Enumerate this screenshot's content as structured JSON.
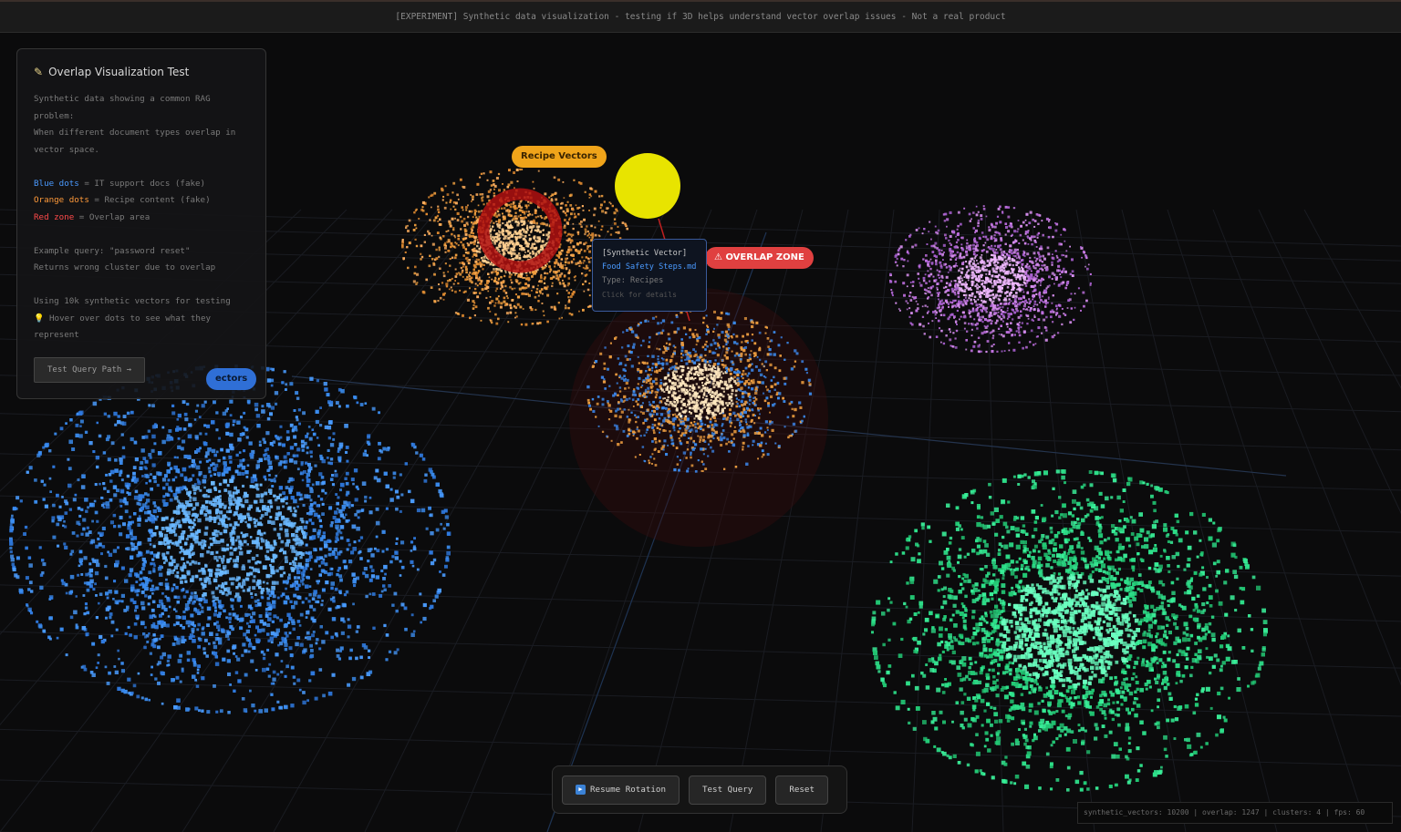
{
  "banner": {
    "text": "[EXPERIMENT] Synthetic data visualization - testing if 3D helps understand vector overlap issues - Not a real product"
  },
  "panel": {
    "title": "Overlap Visualization Test",
    "intro_1": "Synthetic data showing a common RAG",
    "intro_2": "problem:",
    "intro_3": "When different document types overlap in",
    "intro_4": "vector space.",
    "legend_blue_term": "Blue dots",
    "legend_blue_desc": " = IT support docs (fake)",
    "legend_orange_term": "Orange dots",
    "legend_orange_desc": " = Recipe content (fake)",
    "legend_red_term": "Red zone",
    "legend_red_desc": " = Overlap area",
    "query_1": "Example query: \"password reset\"",
    "query_2": "Returns wrong cluster due to overlap",
    "using": "Using 10k synthetic vectors for testing",
    "hover_1": "Hover over dots to see what they",
    "hover_2": "represent",
    "button": "Test Query Path →"
  },
  "labels": {
    "recipe": "Recipe Vectors",
    "overlap": "⚠ OVERLAP ZONE",
    "it": "ectors"
  },
  "tooltip": {
    "head": "[Synthetic Vector]",
    "file": "Food Safety Steps.md",
    "type": "Type: Recipes",
    "hint": "Click for details"
  },
  "controls": {
    "resume": "Resume Rotation",
    "test": "Test Query",
    "reset": "Reset"
  },
  "status": {
    "text": "synthetic_vectors: 10200 | overlap: 1247 | clusters: 4 | fps: 60"
  },
  "colors": {
    "it": "#3b8df0",
    "recipe": "#f0a040",
    "purple": "#c070e0",
    "green": "#2ee08a",
    "overlap": "#e04040",
    "query_node": "#e8e400"
  },
  "icons": {
    "panel_title": "pencil-icon",
    "hover_hint": "lightbulb-icon",
    "resume": "play-icon",
    "overlap_tag": "warning-icon"
  }
}
